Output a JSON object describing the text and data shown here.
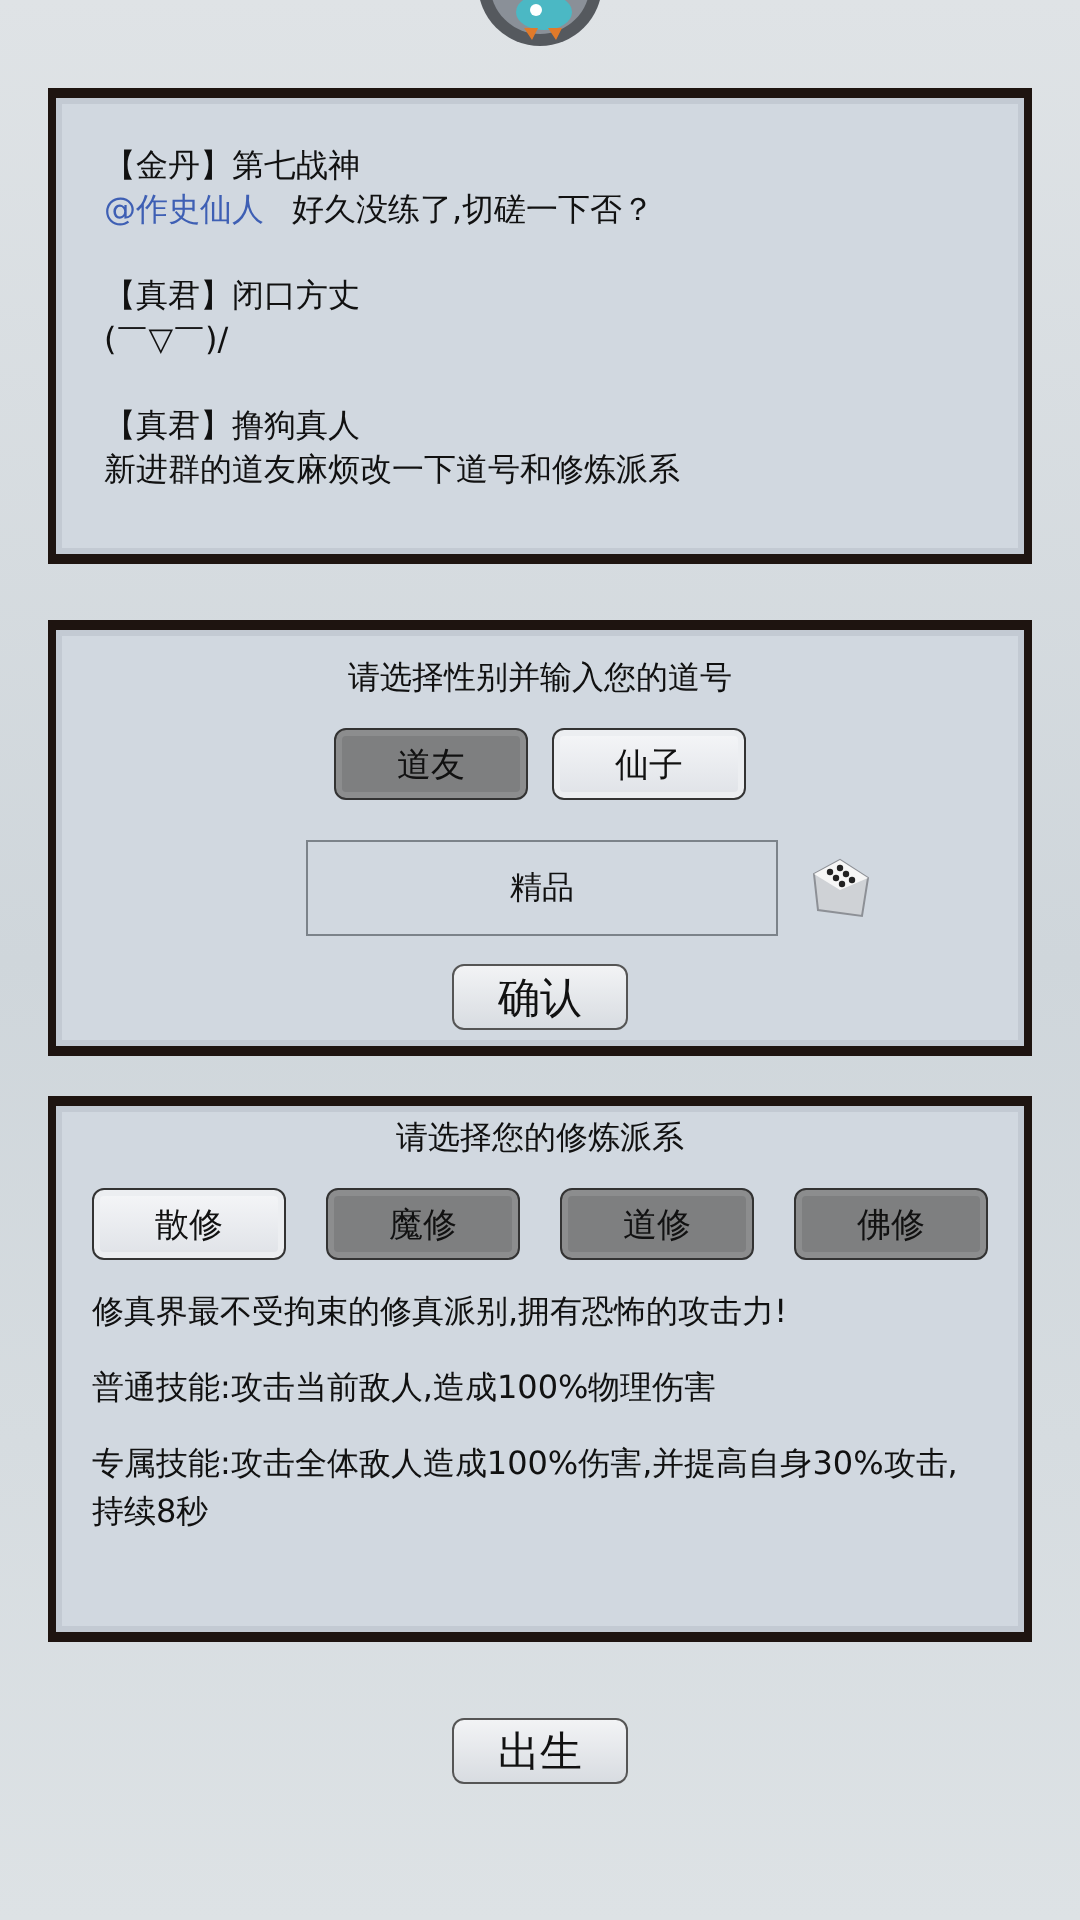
{
  "chat": [
    {
      "author": "【金丹】第七战神",
      "mention": "@作史仙人",
      "text": "好久没练了,切磋一下否？"
    },
    {
      "author": "【真君】闭口方丈",
      "text": "(￣▽￣)/"
    },
    {
      "author": "【真君】撸狗真人",
      "text": "新进群的道友麻烦改一下道号和修炼派系"
    }
  ],
  "name_panel": {
    "title": "请选择性别并输入您的道号",
    "genders": [
      {
        "label": "道友",
        "selected": false
      },
      {
        "label": "仙子",
        "selected": true
      }
    ],
    "name_field": {
      "value": "精品"
    },
    "confirm": "确认"
  },
  "school_panel": {
    "title": "请选择您的修炼派系",
    "schools": [
      {
        "label": "散修",
        "selected": true
      },
      {
        "label": "魔修",
        "selected": false
      },
      {
        "label": "道修",
        "selected": false
      },
      {
        "label": "佛修",
        "selected": false
      }
    ],
    "description": [
      "修真界最不受拘束的修真派别,拥有恐怖的攻击力!",
      "普通技能:攻击当前敌人,造成100%物理伤害",
      "专属技能:攻击全体敌人造成100%伤害,并提高自身30%攻击,持续8秒"
    ]
  },
  "birth_button": "出生"
}
